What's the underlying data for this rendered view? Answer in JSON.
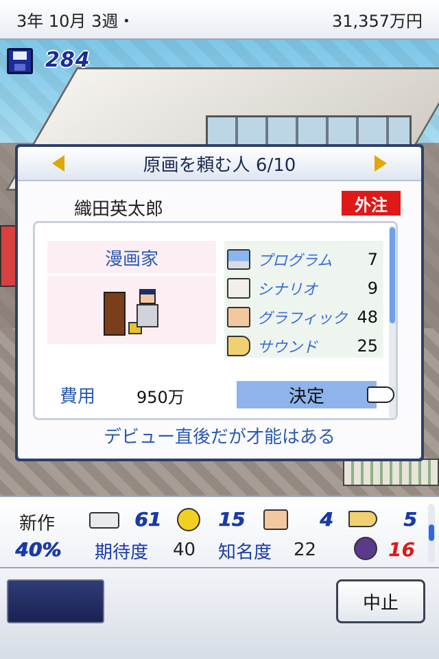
{
  "status_bar": {
    "date": "3年  10月  3週・",
    "money": "31,357万円"
  },
  "save": {
    "icon": "floppy-disk-icon",
    "count": "284"
  },
  "dialog": {
    "title": "原画を頼む人  6/10",
    "name": "織田英太郎",
    "badge": "外注",
    "job": "漫画家",
    "stats": [
      {
        "icon": "computer-icon",
        "label": "プログラム",
        "value": "7"
      },
      {
        "icon": "book-icon",
        "label": "シナリオ",
        "value": "9"
      },
      {
        "icon": "paintbrush-icon",
        "label": "グラフィック",
        "value": "48"
      },
      {
        "icon": "trumpet-icon",
        "label": "サウンド",
        "value": "25"
      }
    ],
    "cost_label": "費用",
    "cost_value": "950万",
    "decide": "決定",
    "comment": "デビュー直後だが才能はある"
  },
  "info_panel": {
    "new_label": "新作",
    "percent": "40%",
    "controller_value": "61",
    "coin_value": "15",
    "brush_value": "4",
    "trumpet_value": "5",
    "expectation_label": "期待度",
    "expectation_value": "40",
    "fame_label": "知名度",
    "fame_value": "22",
    "bug_value": "16"
  },
  "footer": {
    "cancel": "中止"
  },
  "colors": {
    "accent_blue": "#2a5ab0",
    "badge_red": "#e01818",
    "button_blue": "#8fb4ec",
    "dialog_border": "#2d3f6a"
  }
}
